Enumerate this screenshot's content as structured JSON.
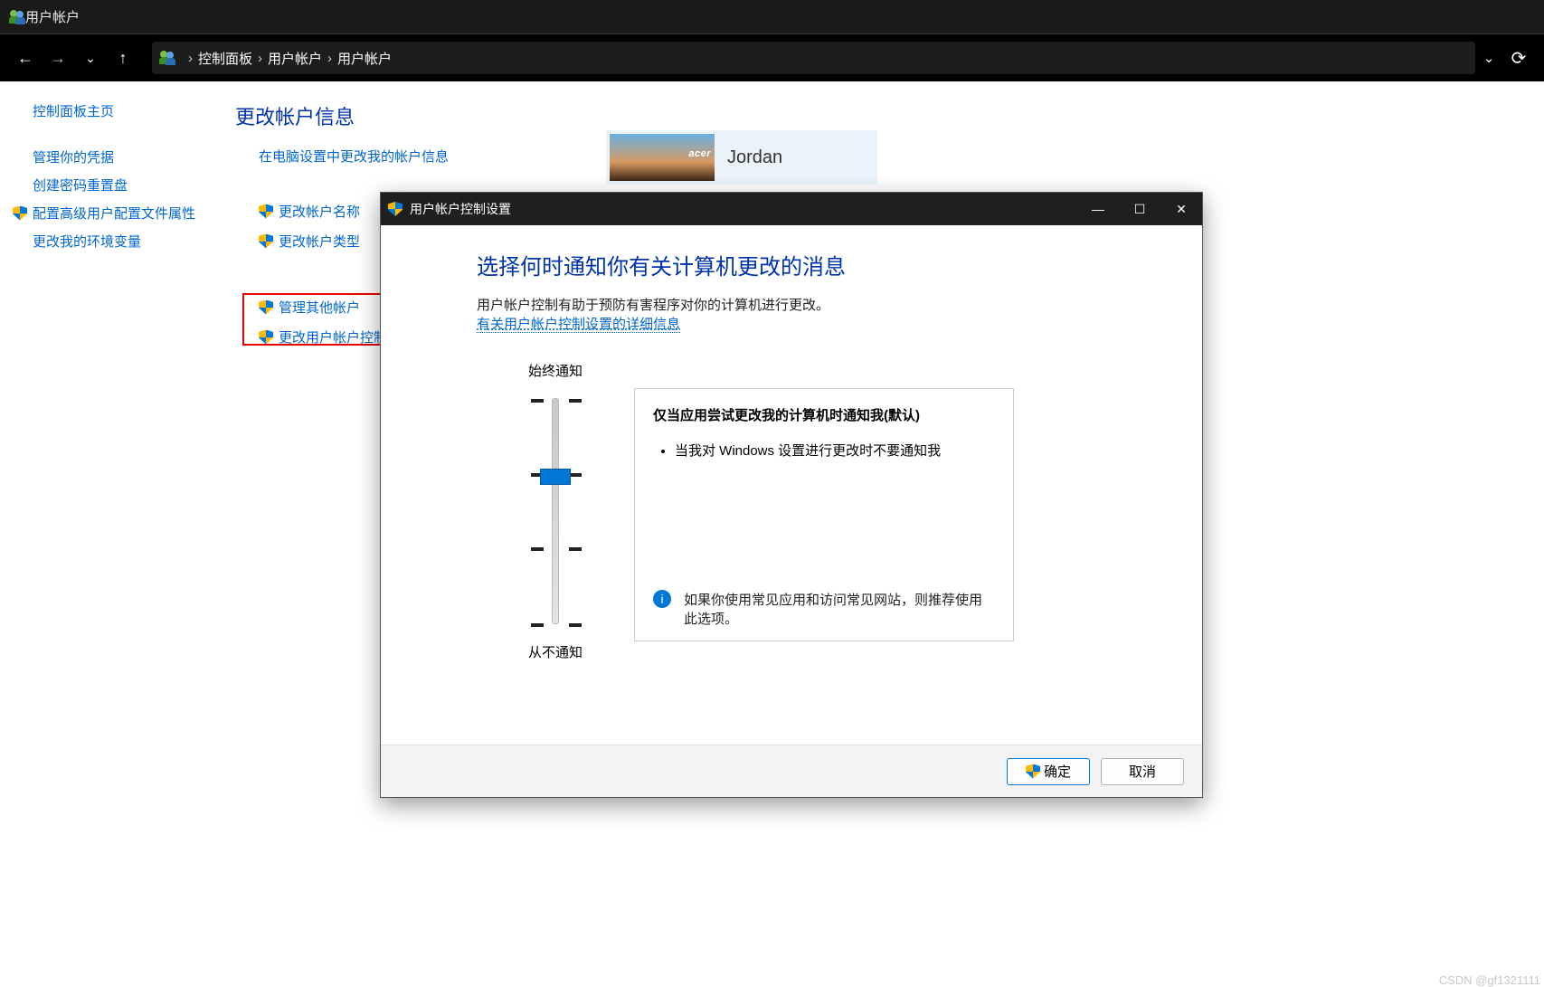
{
  "window": {
    "title": "用户帐户"
  },
  "breadcrumb": {
    "items": [
      "控制面板",
      "用户帐户",
      "用户帐户"
    ]
  },
  "sidebar": {
    "home": "控制面板主页",
    "links": [
      "管理你的凭据",
      "创建密码重置盘",
      "配置高级用户配置文件属性",
      "更改我的环境变量"
    ],
    "shield_index": 2
  },
  "main": {
    "heading": "更改帐户信息",
    "actions": {
      "change_in_settings": "在电脑设置中更改我的帐户信息",
      "change_name": "更改帐户名称",
      "change_type": "更改帐户类型",
      "manage_other": "管理其他帐户",
      "change_uac": "更改用户帐户控制设置"
    }
  },
  "user_card": {
    "brand": "acer",
    "name": "Jordan"
  },
  "dialog": {
    "title": "用户帐户控制设置",
    "heading": "选择何时通知你有关计算机更改的消息",
    "description": "用户帐户控制有助于预防有害程序对你的计算机进行更改。",
    "more_link": "有关用户帐户控制设置的详细信息",
    "slider_top_label": "始终通知",
    "slider_bottom_label": "从不通知",
    "panel_heading": "仅当应用尝试更改我的计算机时通知我(默认)",
    "panel_bullet1": "当我对 Windows 设置进行更改时不要通知我",
    "panel_info": "如果你使用常见应用和访问常见网站，则推荐使用此选项。",
    "ok": "确定",
    "cancel": "取消"
  },
  "watermark": "CSDN @gf1321111"
}
